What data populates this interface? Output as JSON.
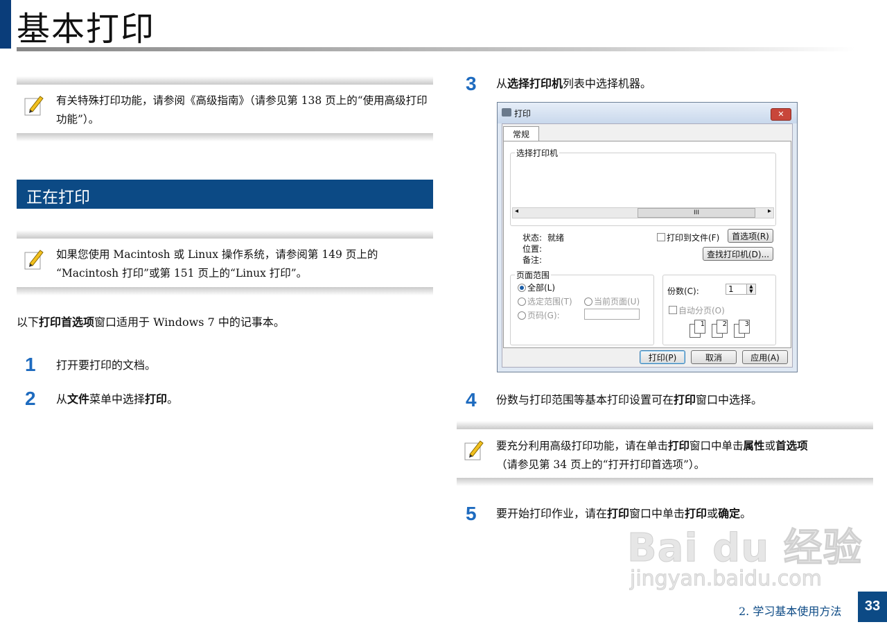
{
  "page_title": "基本打印",
  "note1": "有关特殊打印功能，请参阅《高级指南》（请参见第 138 页上的“使用高级打印功能”）。",
  "section_title": "正在打印",
  "note2_line1": "如果您使用 Macintosh 或 Linux 操作系统，请参阅第 149 页上的",
  "note2_line2": "“Macintosh 打印”或第 151 页上的“Linux 打印”。",
  "intro": {
    "pre": "以下",
    "bold": "打印首选项",
    "post": "窗口适用于 Windows 7 中的记事本。"
  },
  "steps": [
    {
      "num": "1",
      "text": "打开要打印的文档。"
    },
    {
      "num": "2",
      "pre": "从",
      "b1": "文件",
      "mid": "菜单中选择",
      "b2": "打印",
      "post": "。"
    },
    {
      "num": "3",
      "pre": "从",
      "b1": "选择打印机",
      "post": "列表中选择机器。"
    },
    {
      "num": "4",
      "pre": "份数与打印范围等基本打印设置可在",
      "b1": "打印",
      "post": "窗口中选择。"
    },
    {
      "num": "5",
      "pre": "要开始打印作业，请在",
      "b1": "打印",
      "mid": "窗口中单击",
      "b2": "打印",
      "mid2": "或",
      "b3": "确定",
      "post": "。"
    }
  ],
  "note3": {
    "pre": "要充分利用高级打印功能，请在单击",
    "b1": "打印",
    "mid": "窗口中单击",
    "b2": "属性",
    "mid2": "或",
    "b3": "首选项",
    "line2": "（请参见第 34 页上的“打开打印首选项”）。"
  },
  "dialog": {
    "title": "打印",
    "close": "✕",
    "tab": "常规",
    "select_printer": "选择打印机",
    "scroll_grip": "III",
    "status_label": "状态:",
    "status_value": "就绪",
    "location_label": "位置:",
    "comment_label": "备注:",
    "print_to_file": "打印到文件(F)",
    "preferences": "首选项(R)",
    "find_printer": "查找打印机(D)...",
    "page_range": "页面范围",
    "all": "全部(L)",
    "selection": "选定范围(T)",
    "current_page": "当前页面(U)",
    "pages": "页码(G):",
    "copies_label": "份数(C):",
    "copies_value": "1",
    "collate": "自动分页(O)",
    "print_btn": "打印(P)",
    "cancel_btn": "取消",
    "apply_btn": "应用(A)"
  },
  "watermark": {
    "logo": "Bai du 经验",
    "url": "jingyan.baidu.com"
  },
  "footer": {
    "chapter": "2. 学习基本使用方法",
    "page": "33"
  }
}
